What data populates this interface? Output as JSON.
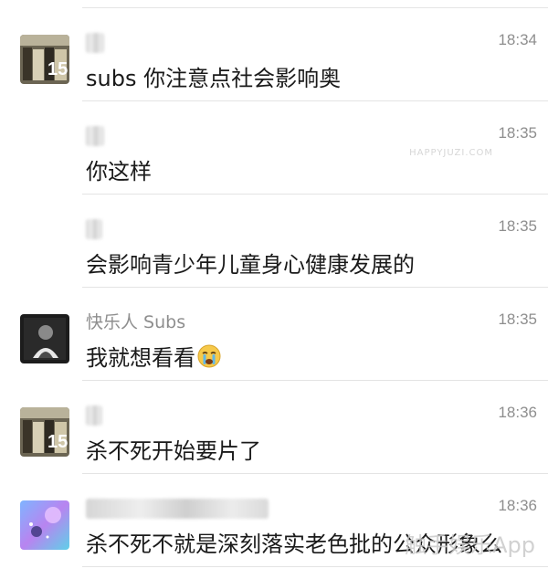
{
  "messages": [
    {
      "avatar": "poster-avatar",
      "sender": "",
      "name_blurred": true,
      "time": "18:34",
      "text": "subs 你注意点社会影响奥"
    },
    {
      "avatar": "",
      "sender": "",
      "name_blurred": true,
      "time": "18:35",
      "text": "你这样"
    },
    {
      "avatar": "",
      "sender": "",
      "name_blurred": true,
      "time": "18:35",
      "text": "会影响青少年儿童身心健康发展的"
    },
    {
      "avatar": "dark-avatar",
      "sender": "快乐人 Subs",
      "name_blurred": false,
      "time": "18:35",
      "text": "我就想看看",
      "emoji": "crying-face-emoji"
    },
    {
      "avatar": "poster-avatar",
      "sender": "",
      "name_blurred": true,
      "time": "18:36",
      "text": "杀不死开始要片了"
    },
    {
      "avatar": "galaxy-avatar",
      "sender": "",
      "name_blurred": true,
      "time": "18:36",
      "text": "杀不死不就是深刻落实老色批的公众形象么"
    }
  ],
  "watermark": {
    "text": "触手娱乐App",
    "sub": "HAPPYJUZI.COM"
  },
  "colors": {
    "name": "#8e8e8e",
    "time": "#8e8e8e",
    "text": "#1a1a1a",
    "separator": "#e4e4e4"
  }
}
